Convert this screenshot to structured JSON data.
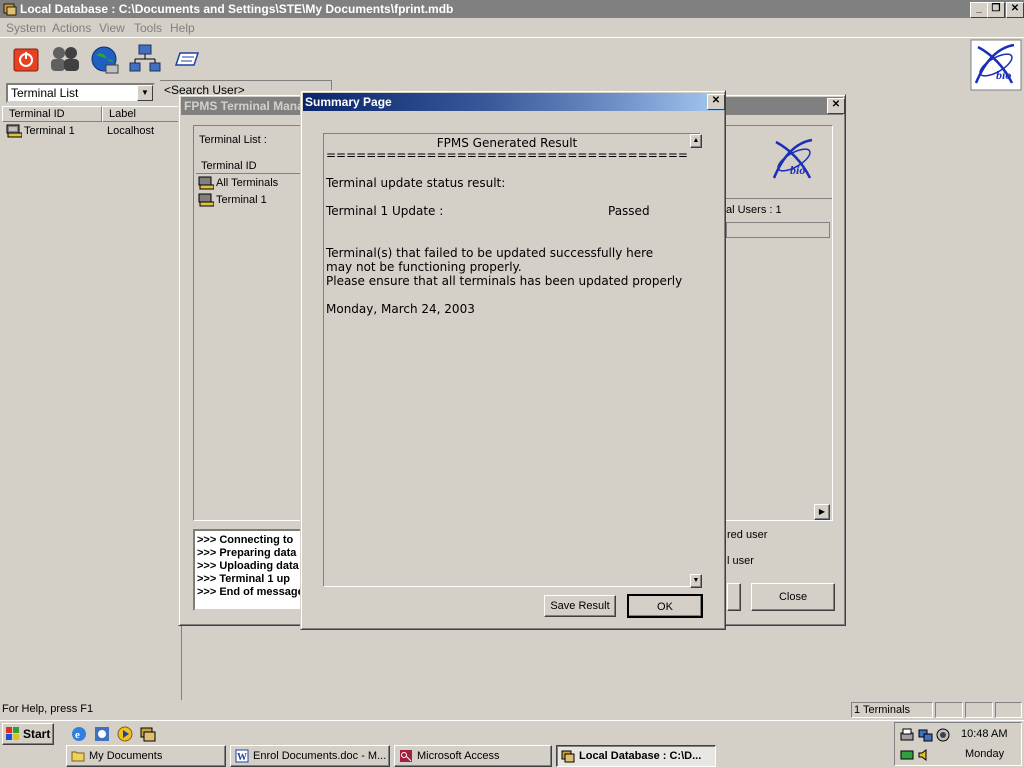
{
  "main_window": {
    "title": "Local Database : C:\\Documents and Settings\\STE\\My Documents\\fprint.mdb",
    "caption_min": "_",
    "caption_max": "❐",
    "caption_close": "✕"
  },
  "menu": [
    "System",
    "Actions",
    "View",
    "Tools",
    "Help"
  ],
  "toolbar": {
    "icons": [
      "power-icon",
      "users-icon",
      "globe-icon",
      "network-icon",
      "card-icon"
    ]
  },
  "view_select": {
    "value": "Terminal List"
  },
  "search_user": {
    "value": "<Search User>"
  },
  "terminal_list": {
    "headers": [
      "Terminal ID",
      "Label"
    ],
    "rows": [
      {
        "id": "Terminal 1",
        "label": "Localhost"
      }
    ]
  },
  "fpms_window": {
    "title": "FPMS Terminal Manager",
    "terminal_list_label": "Terminal List :",
    "tree_header": "Terminal ID",
    "tree_items": [
      "All Terminals",
      "Terminal 1"
    ],
    "users_label": "al Users : 1",
    "log": [
      ">>> Connecting to",
      ">>> Preparing data",
      ">>> Uploading data",
      ">>> Terminal 1 up",
      ">>> End of message"
    ],
    "option1": "red user",
    "option2": "l user",
    "close_label": "Close"
  },
  "summary": {
    "title": "Summary Page",
    "close_glyph": "✕",
    "heading": "FPMS Generated Result",
    "separator": "====================================",
    "status_heading": "Terminal update status result:",
    "update_label": "Terminal 1 Update :",
    "update_status": "Passed",
    "warning_1": "Terminal(s) that failed to be updated successfully here",
    "warning_2": "may not be functioning properly.",
    "warning_3": "Please ensure that all terminals has been updated properly",
    "date": "Monday, March 24, 2003",
    "save_label": "Save Result",
    "ok_label": "OK"
  },
  "statusbar": {
    "help": "For Help, press F1",
    "terminals": "1 Terminals"
  },
  "taskbar": {
    "start_label": "Start",
    "tasks": [
      "My Documents",
      "Enrol Documents.doc - M...",
      "Microsoft Access",
      "Local Database : C:\\D..."
    ],
    "time": "10:48 AM",
    "day": "Monday"
  },
  "colors": {
    "title_active_start": "#0a246a",
    "title_active_end": "#a6caf0",
    "title_inactive": "#808080",
    "face": "#d4d0c8",
    "bio_logo_blue": "#1a2fb8"
  }
}
